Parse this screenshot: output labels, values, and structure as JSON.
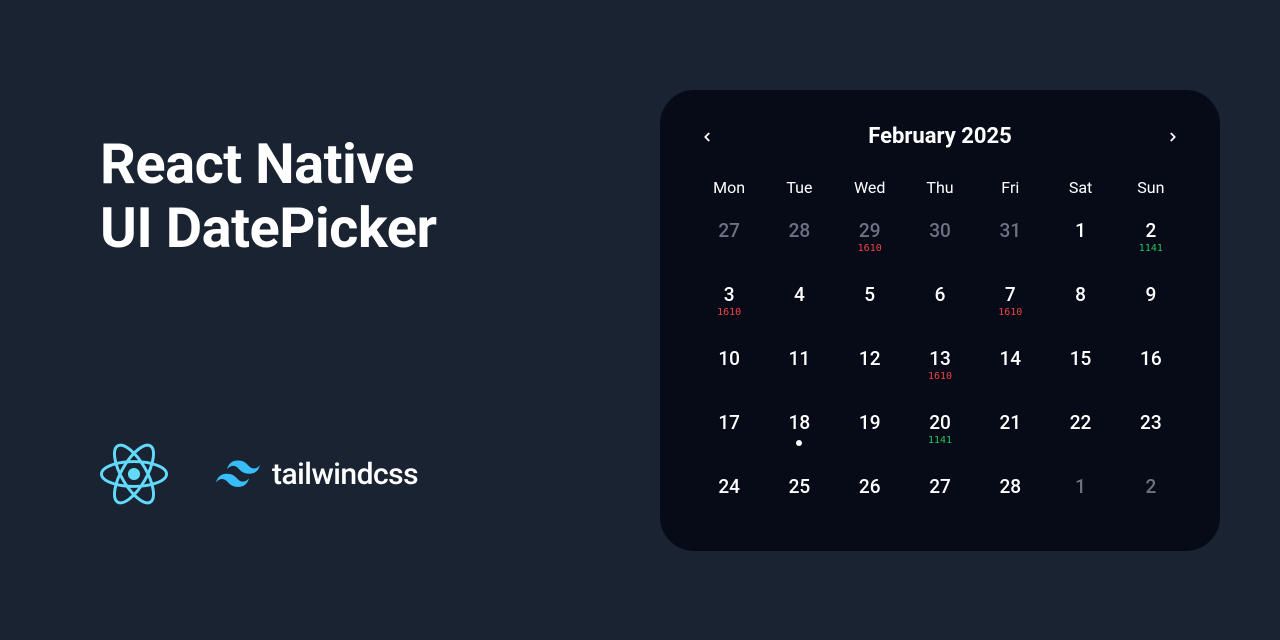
{
  "hero": {
    "title_line1": "React Native",
    "title_line2": "UI DatePicker",
    "tailwind_label": "tailwindcss"
  },
  "calendar": {
    "month_label": "February 2025",
    "weekdays": [
      "Mon",
      "Tue",
      "Wed",
      "Thu",
      "Fri",
      "Sat",
      "Sun"
    ],
    "days": [
      {
        "n": "27",
        "out": true
      },
      {
        "n": "28",
        "out": true
      },
      {
        "n": "29",
        "out": true,
        "badge": "1610",
        "badgeColor": "red"
      },
      {
        "n": "30",
        "out": true
      },
      {
        "n": "31",
        "out": true
      },
      {
        "n": "1"
      },
      {
        "n": "2",
        "badge": "1141",
        "badgeColor": "green"
      },
      {
        "n": "3",
        "badge": "1610",
        "badgeColor": "red"
      },
      {
        "n": "4"
      },
      {
        "n": "5"
      },
      {
        "n": "6"
      },
      {
        "n": "7",
        "badge": "1610",
        "badgeColor": "red"
      },
      {
        "n": "8"
      },
      {
        "n": "9"
      },
      {
        "n": "10"
      },
      {
        "n": "11"
      },
      {
        "n": "12"
      },
      {
        "n": "13",
        "badge": "1610",
        "badgeColor": "red"
      },
      {
        "n": "14"
      },
      {
        "n": "15"
      },
      {
        "n": "16"
      },
      {
        "n": "17"
      },
      {
        "n": "18",
        "dot": true
      },
      {
        "n": "19"
      },
      {
        "n": "20",
        "badge": "1141",
        "badgeColor": "green"
      },
      {
        "n": "21"
      },
      {
        "n": "22"
      },
      {
        "n": "23"
      },
      {
        "n": "24"
      },
      {
        "n": "25"
      },
      {
        "n": "26"
      },
      {
        "n": "27"
      },
      {
        "n": "28"
      },
      {
        "n": "1",
        "out": true
      },
      {
        "n": "2",
        "out": true
      }
    ]
  },
  "colors": {
    "bg": "#1a2332",
    "panel": "#070b17",
    "react": "#61dafb",
    "tailwind": "#38bdf8",
    "badge_red": "#ef4444",
    "badge_green": "#22c55e"
  }
}
